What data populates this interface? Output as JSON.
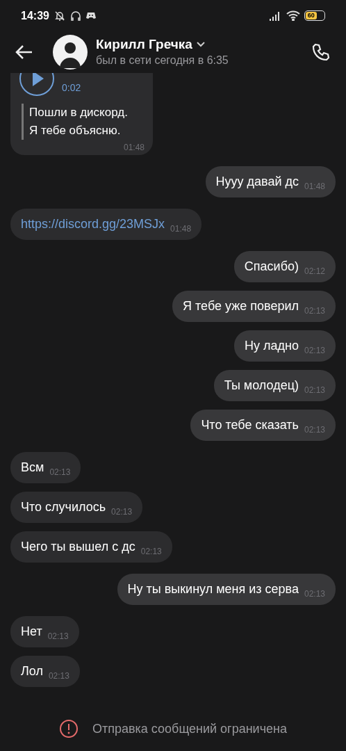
{
  "status_bar": {
    "time": "14:39",
    "battery": "60"
  },
  "header": {
    "name": "Кирилл Гречка",
    "last_seen": "был в сети сегодня в 6:35"
  },
  "messages": [
    {
      "kind": "voice",
      "outgoing": false,
      "duration": "0:02",
      "transcript": "Пошли в дискорд.\nЯ тебе объясню.",
      "time": "01:48"
    },
    {
      "kind": "text",
      "outgoing": true,
      "text": "Нууу давай дс",
      "time": "01:48"
    },
    {
      "kind": "link",
      "outgoing": false,
      "text": "https://discord.gg/23MSJx",
      "time": "01:48"
    },
    {
      "kind": "text",
      "outgoing": true,
      "text": "Спасибо)",
      "time": "02:12"
    },
    {
      "kind": "text",
      "outgoing": true,
      "text": "Я тебе уже поверил",
      "time": "02:13"
    },
    {
      "kind": "text",
      "outgoing": true,
      "text": "Ну ладно",
      "time": "02:13"
    },
    {
      "kind": "text",
      "outgoing": true,
      "text": "Ты молодец)",
      "time": "02:13"
    },
    {
      "kind": "text",
      "outgoing": true,
      "text": "Что тебе сказать",
      "time": "02:13"
    },
    {
      "kind": "text",
      "outgoing": false,
      "text": "Всм",
      "time": "02:13"
    },
    {
      "kind": "text",
      "outgoing": false,
      "text": "Что случилось",
      "time": "02:13"
    },
    {
      "kind": "text",
      "outgoing": false,
      "text": "Чего ты вышел с дс",
      "time": "02:13"
    },
    {
      "kind": "text",
      "outgoing": true,
      "text": "Ну ты выкинул меня из серва",
      "time": "02:13"
    },
    {
      "kind": "text",
      "outgoing": false,
      "text": "Нет",
      "time": "02:13"
    },
    {
      "kind": "text",
      "outgoing": false,
      "text": "Лол",
      "time": "02:13"
    }
  ],
  "footer": {
    "notice": "Отправка сообщений ограничена"
  }
}
